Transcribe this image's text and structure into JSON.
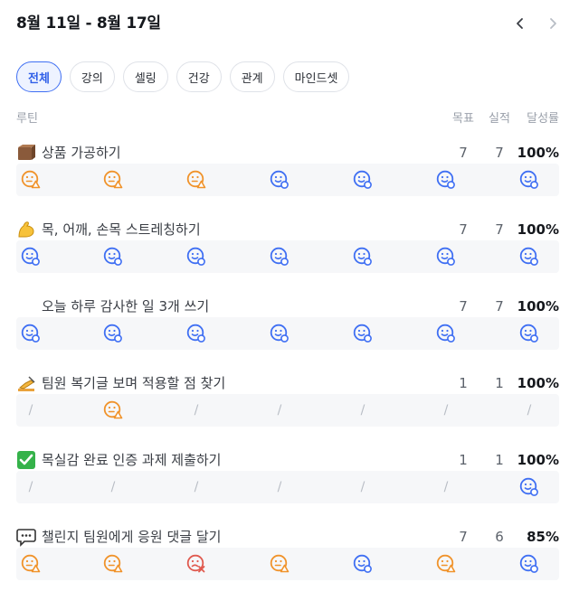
{
  "header": {
    "title": "8월 11일 - 8월 17일",
    "prev_icon": "chevron-left-icon",
    "next_icon": "chevron-right-icon"
  },
  "tabs": [
    {
      "label": "전체",
      "active": true
    },
    {
      "label": "강의",
      "active": false
    },
    {
      "label": "셀링",
      "active": false
    },
    {
      "label": "건강",
      "active": false
    },
    {
      "label": "관계",
      "active": false
    },
    {
      "label": "마인드셋",
      "active": false
    }
  ],
  "columns": {
    "routine": "루틴",
    "goal": "목표",
    "actual": "실적",
    "rate": "달성률"
  },
  "colors": {
    "accent": "#3f6ff3",
    "done": "#3f6ff3",
    "partial": "#f0932b",
    "missed": "#e05a4f"
  },
  "routines": [
    {
      "emoji": "box",
      "name": "상품 가공하기",
      "goal": "7",
      "actual": "7",
      "rate": "100%",
      "days": [
        "partial",
        "partial",
        "partial",
        "done",
        "done",
        "done",
        "done"
      ]
    },
    {
      "emoji": "flexed-biceps",
      "name": "목, 어깨, 손목 스트레칭하기",
      "goal": "7",
      "actual": "7",
      "rate": "100%",
      "days": [
        "done",
        "done",
        "done",
        "done",
        "done",
        "done",
        "done"
      ]
    },
    {
      "emoji": "",
      "name": "오늘 하루 감사한 일 3개 쓰기",
      "goal": "7",
      "actual": "7",
      "rate": "100%",
      "days": [
        "done",
        "done",
        "done",
        "done",
        "done",
        "done",
        "done"
      ]
    },
    {
      "emoji": "writing-hand",
      "name": "팀원 복기글 보며 적용할 점 찾기",
      "goal": "1",
      "actual": "1",
      "rate": "100%",
      "days": [
        "none",
        "partial",
        "none",
        "none",
        "none",
        "none",
        "none"
      ]
    },
    {
      "emoji": "check-box",
      "name": "목실감 완료 인증 과제 제출하기",
      "goal": "1",
      "actual": "1",
      "rate": "100%",
      "days": [
        "none",
        "none",
        "none",
        "none",
        "none",
        "none",
        "done"
      ]
    },
    {
      "emoji": "speech-bubble",
      "name": "챌린지 팀원에게 응원 댓글 달기",
      "goal": "7",
      "actual": "6",
      "rate": "85%",
      "days": [
        "partial",
        "partial",
        "missed",
        "partial",
        "done",
        "partial",
        "done"
      ]
    }
  ]
}
